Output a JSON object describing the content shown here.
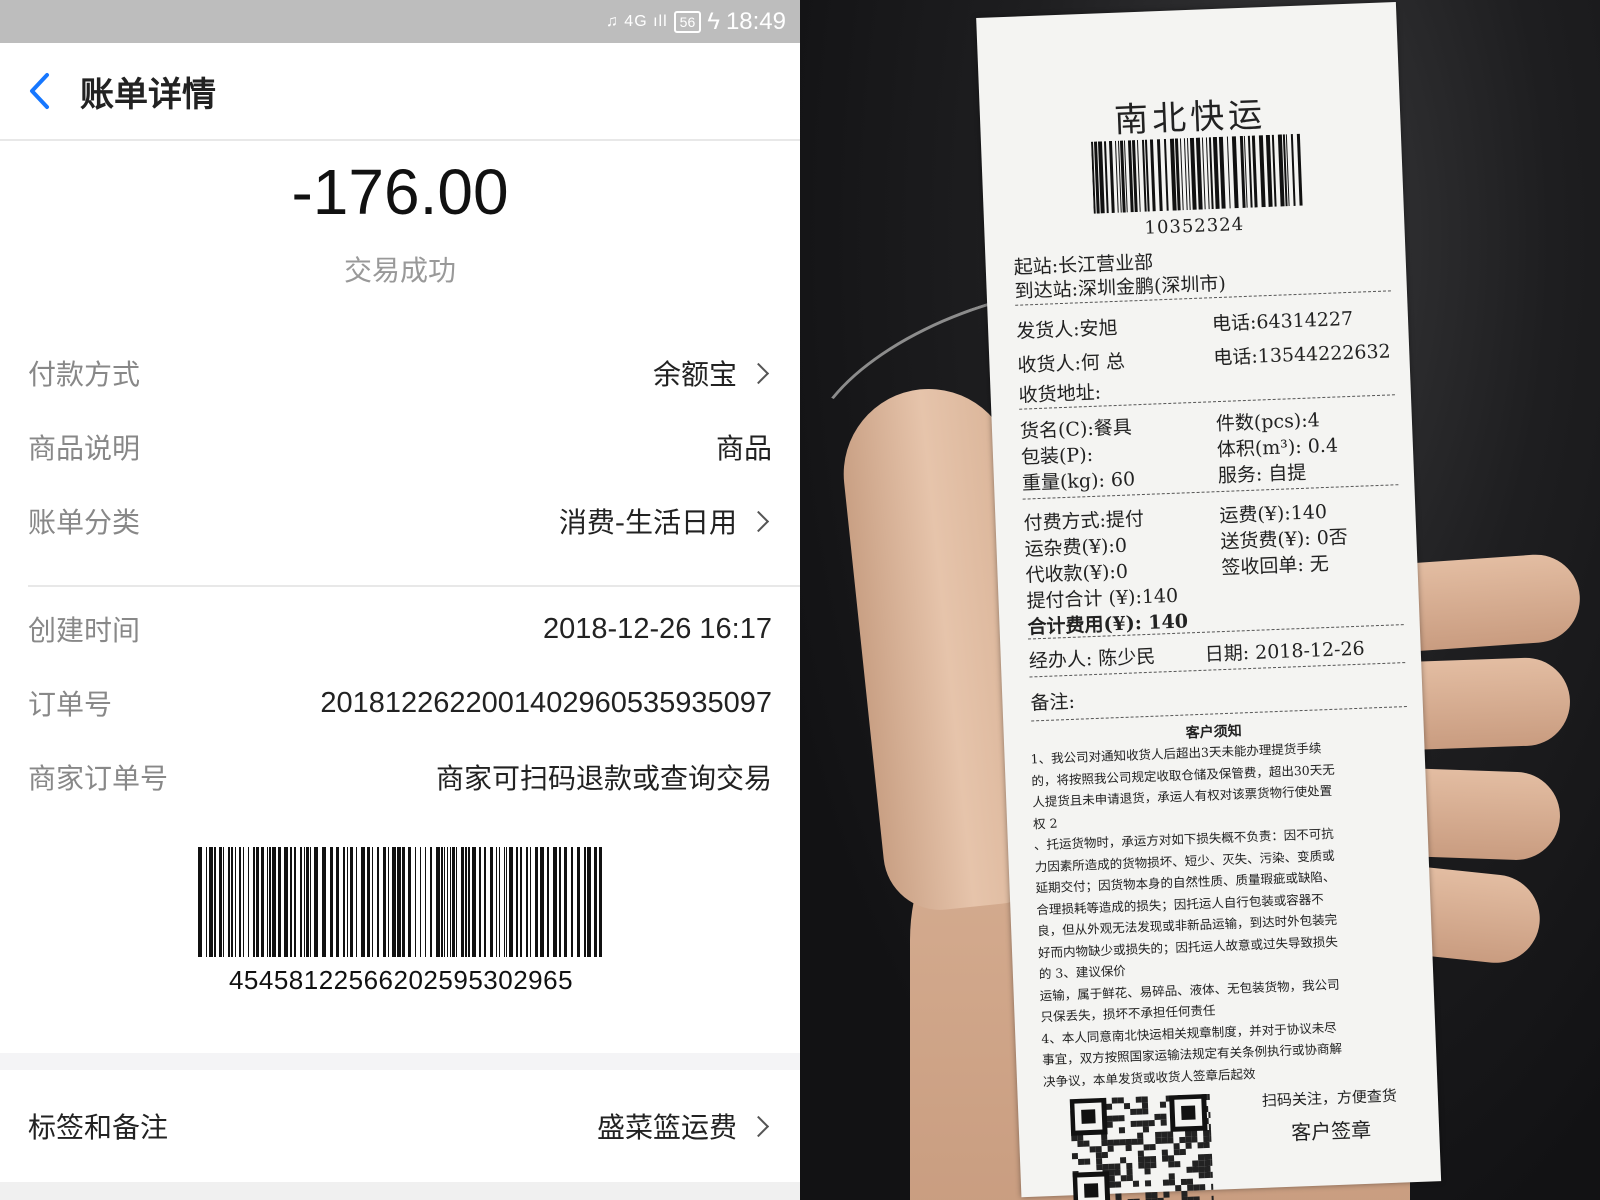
{
  "statusbar": {
    "icons": "♫ 4G ıll",
    "battery": "56",
    "time": "18:49"
  },
  "nav": {
    "title": "账单详情"
  },
  "amount": "-176.00",
  "status": "交易成功",
  "rows": [
    {
      "label": "付款方式",
      "value": "余额宝"
    },
    {
      "label": "商品说明",
      "value": "商品"
    },
    {
      "label": "账单分类",
      "value": "消费-生活日用"
    },
    {
      "label": "创建时间",
      "value": "2018-12-26 16:17"
    },
    {
      "label": "订单号",
      "value": "2018122622001402960535935097"
    },
    {
      "label": "商家订单号",
      "value": "商家可扫码退款或查询交易"
    }
  ],
  "barcode_number": "4545812256620259530296​5",
  "tags": {
    "label": "标签和备注",
    "value": "盛菜篮运费"
  },
  "receipt": {
    "title": "南北快运",
    "barcode_number": "10352324",
    "origin": "起站:长江营业部",
    "destination": "到达站:深圳金鹏(深圳市)",
    "sender": "发货人:安旭",
    "sender_phone": "电话:64314227",
    "receiver": "收货人:何 总",
    "receiver_phone": "电话:13544222632",
    "address": "收货地址:",
    "goods": "货名(C):餐具",
    "pieces": "件数(pcs):4",
    "package": "包装(P):",
    "volume": "体积(m³): 0.4",
    "weight": "重量(kg): 60",
    "service": "服务: 自提",
    "pay_method": "付费方式:提付",
    "freight": "运费(¥):140",
    "misc_fee": "运杂费(¥):0",
    "delivery_fee": "送货费(¥): 0否",
    "cod": "代收款(¥):0",
    "receipt_return": "签收回单: 无",
    "pickup_total": "提付合计 (¥):140",
    "grand_total": "合计费用(¥): 140",
    "handler": "经办人: 陈少民",
    "date": "日期: 2018-12-26",
    "remarks": "备注:",
    "notice_title": "客户须知",
    "notice_text": "1、我公司对通知收货人后超出3天未能办理提货手续\n的，将按照我公司规定收取仓储及保管费，超出30天无\n人提货且未申请退货，承运人有权对该票货物行使处置\n权                                                              2\n、托运货物时，承运方对如下损失概不负责：因不可抗\n力因素所造成的货物损坏、短少、灭失、污染、变质或\n延期交付；因货物本身的自然性质、质量瑕疵或缺陷、\n合理损耗等造成的损失；因托运人自行包装或容器不\n良，但从外观无法发现或非新品运输，到达时外包装完\n好而内物缺少或损失的；因托运人故意或过失导致损失\n的                                                   3、建议保价\n运输，属于鲜花、易碎品、液体、无包装货物，我公司\n只保丢失，损坏不承担任何责任\n4、本人同意南北快运相关规章制度，并对于协议未尽\n事宜，双方按照国家运输法规定有关条例执行或协商解\n决争议，本单发货或收货人签章后起效",
    "scan_text": "扫码关注，方便查货",
    "sign_text": "客户签章"
  }
}
